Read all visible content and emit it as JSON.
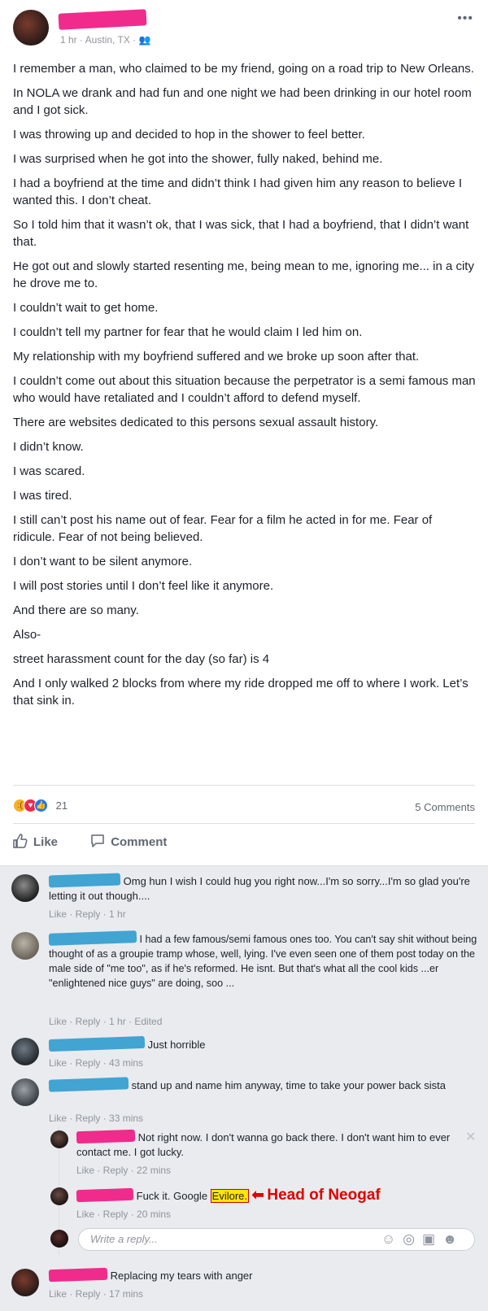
{
  "post": {
    "meta": "1 hr · Austin, TX · ",
    "audience_icon": "friends-icon",
    "more_icon": "ellipsis-icon",
    "paragraphs": [
      "I remember a man, who claimed to be my friend, going on a road trip to New Orleans.",
      "In NOLA we drank and had fun and one night we had been drinking in our hotel room and I got sick.",
      "I was throwing up and decided to hop in the shower to feel better.",
      "I was surprised when he got into the shower, fully naked, behind me.",
      "I had a boyfriend at the time and didn’t think I had given him any reason to believe I wanted this. I don’t cheat.",
      "So I told him that it wasn’t ok, that I was sick, that I had a boyfriend, that I didn’t want that.",
      "He got out and slowly started resenting me, being mean to me, ignoring me... in a city he drove me to.",
      "I couldn’t wait to get home.",
      "I couldn’t tell my partner for fear that he would claim I led him on.",
      "My relationship with my boyfriend suffered and we broke up soon after that.",
      "I couldn’t come out about this situation because the perpetrator is a semi famous man who would have retaliated and I couldn’t afford to defend myself.",
      "There are websites dedicated to this persons sexual assault history.",
      "I didn’t know.",
      "I was scared.",
      "I was tired.",
      "I still can’t post his name out of fear. Fear for a film he acted in for me. Fear of ridicule. Fear of not being believed.",
      "I don’t want to be silent anymore.",
      "I will post stories until I don’t feel like it anymore.",
      "And there are so many.",
      "Also-",
      "street harassment count for the day (so far) is 4",
      "And I only walked 2 blocks from where my ride dropped me off to where I work. Let’s that sink in."
    ],
    "reaction_count": "21",
    "comments_count": "5 Comments",
    "like_label": "Like",
    "comment_label": "Comment"
  },
  "comments": [
    {
      "text": "Omg hun I wish I could hug you right now...I'm so sorry...I'm so glad you're letting it out though....",
      "actions": "Like · Reply · 1 hr"
    },
    {
      "text": "I had a few famous/semi famous ones too. You can't say shit without being thought of as a groupie tramp whose, well, lying. I've even seen one of them post today on the male side of \"me too\", as if he's reformed. He isnt. But that's what all the cool kids ...er \"enlightened nice guys\" are doing, soo ...",
      "actions": "Like · Reply · 1 hr · Edited"
    },
    {
      "text": "Just horrible",
      "actions": "Like · Reply · 43 mins"
    },
    {
      "text": "stand up and name him anyway, time to take your power back sista",
      "actions": "Like · Reply · 33 mins"
    },
    {
      "text": "Replacing my tears with anger",
      "actions": "Like · Reply · 17 mins"
    }
  ],
  "replies": [
    {
      "text": "Not right now. I don't wanna go back there. I don't want him to ever contact me. I got lucky.",
      "actions": "Like · Reply · 22 mins"
    },
    {
      "text_before": "Fuck it. Google ",
      "highlight": "Evilore.",
      "annotation": "Head of Neogaf",
      "actions": "Like · Reply · 20 mins"
    }
  ],
  "reply_placeholder": "Write a reply...",
  "colors": {
    "redact_pink": "#f02b8c",
    "redact_blue": "#41a4d2",
    "annotation_red": "#e00000",
    "highlight_yellow": "#ffe600"
  }
}
